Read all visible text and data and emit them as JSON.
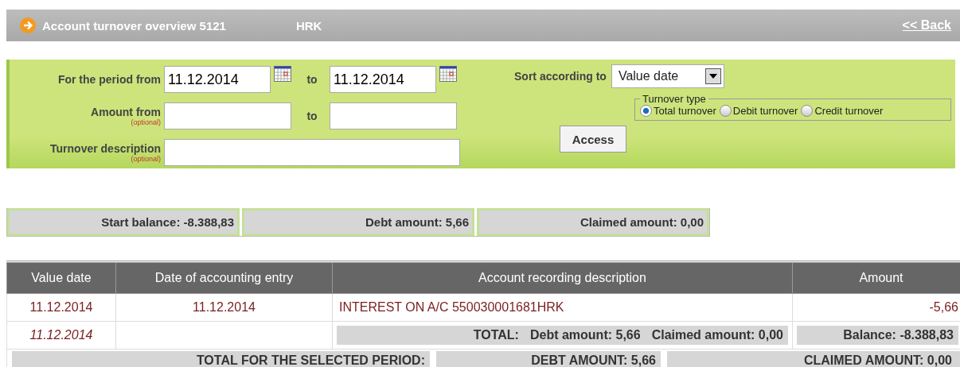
{
  "header": {
    "title": "Account turnover overview 5121",
    "currency": "HRK",
    "back_link": "<< Back"
  },
  "filter": {
    "period_label": "For the period from",
    "date_from": "11.12.2014",
    "to_label_1": "to",
    "date_to": "11.12.2014",
    "amount_label": "Amount from",
    "amount_hint": "(optional)",
    "to_label_2": "to",
    "description_label": "Turnover description",
    "description_hint": "(optional)",
    "sort_label": "Sort according to",
    "sort_value": "Value date",
    "turnover_legend": "Turnover type",
    "turnover_types": [
      {
        "label": "Total turnover",
        "selected": true
      },
      {
        "label": "Debit turnover",
        "selected": false
      },
      {
        "label": "Credit turnover",
        "selected": false
      }
    ],
    "access_button": "Access"
  },
  "summary": [
    "Start balance: -8.388,83",
    "Debt amount: 5,66",
    "Claimed amount: 0,00"
  ],
  "table": {
    "columns": [
      "Value date",
      "Date of accounting entry",
      "Account recording description",
      "Amount"
    ],
    "rows": [
      {
        "value_date": "11.12.2014",
        "entry_date": "11.12.2014",
        "description": "INTEREST ON A/C 550030001681HRK",
        "amount": "-5,66"
      }
    ],
    "total_row": {
      "date": "11.12.2014",
      "label": "TOTAL:",
      "debt": "Debt amount: 5,66",
      "claimed": "Claimed amount: 0,00",
      "balance": "Balance: -8.388,83"
    },
    "period_row": {
      "label": "TOTAL FOR THE SELECTED PERIOD:",
      "debt": "DEBT AMOUNT: 5,66",
      "claimed": "CLAIMED AMOUNT: 0,00"
    }
  }
}
